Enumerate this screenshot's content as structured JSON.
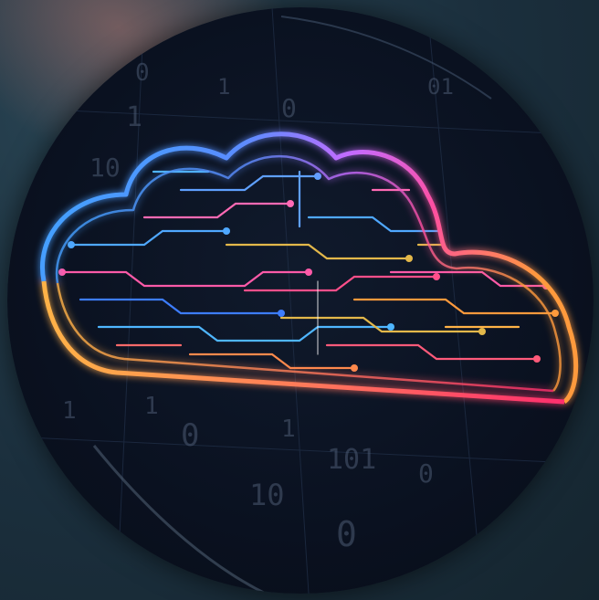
{
  "image": {
    "subject": "cloud-circuit",
    "colors": {
      "background": "#1c3140",
      "circle": "#0a1120",
      "cloud_blue": "#3aa8ff",
      "cloud_pink": "#ff4fa0",
      "cloud_orange": "#ff9a3c",
      "trace_gold": "#e3b84a"
    }
  },
  "binary_digits": [
    "0",
    "1",
    "0",
    "1",
    "10",
    "101",
    "0",
    "10",
    "1",
    "0",
    "0",
    "1",
    "01",
    "1"
  ]
}
